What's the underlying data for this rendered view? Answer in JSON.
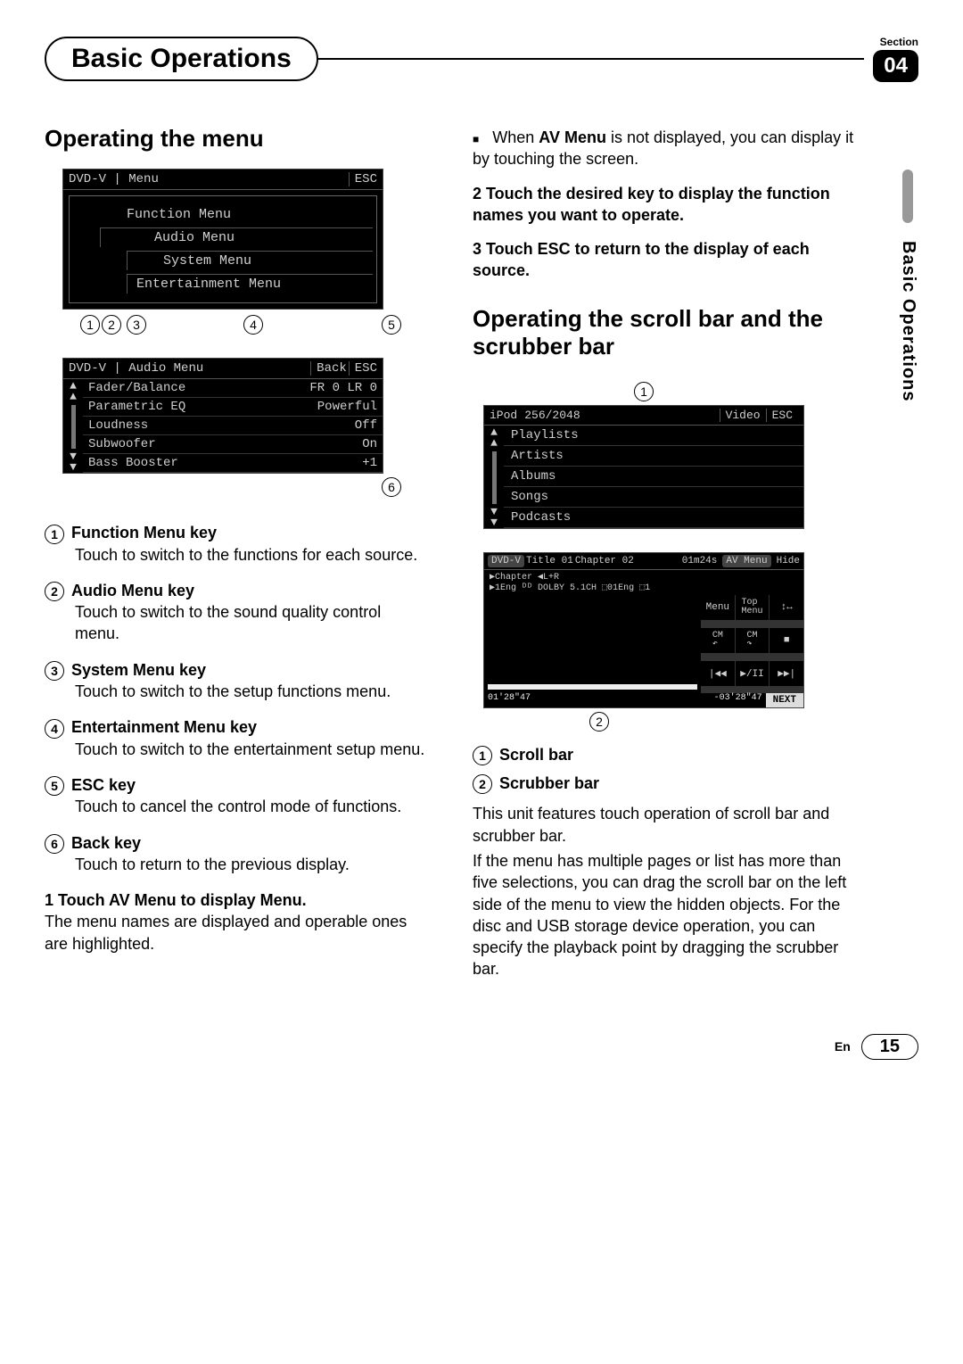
{
  "header": {
    "title": "Basic Operations",
    "section_label": "Section",
    "section_number": "04"
  },
  "side_tab": "Basic Operations",
  "left": {
    "heading": "Operating the menu",
    "menu_screen": {
      "source": "DVD-V",
      "title": "Menu",
      "esc": "ESC",
      "lines": [
        "Function Menu",
        "Audio Menu",
        "System Menu",
        "Entertainment Menu"
      ],
      "callouts": [
        "1",
        "2",
        "3",
        "4",
        "5"
      ]
    },
    "audio_screen": {
      "source": "DVD-V",
      "title": "Audio Menu",
      "back": "Back",
      "esc": "ESC",
      "rows": [
        {
          "name": "Fader/Balance",
          "val": "FR 0 LR 0"
        },
        {
          "name": "Parametric EQ",
          "val": "Powerful"
        },
        {
          "name": "Loudness",
          "val": "Off"
        },
        {
          "name": "Subwoofer",
          "val": "On"
        },
        {
          "name": "Bass Booster",
          "val": "+1"
        }
      ],
      "callout": "6"
    },
    "keys": [
      {
        "num": "1",
        "title": "Function Menu key",
        "desc": "Touch to switch to the functions for each source."
      },
      {
        "num": "2",
        "title": "Audio Menu key",
        "desc": "Touch to switch to the sound quality control menu."
      },
      {
        "num": "3",
        "title": "System Menu key",
        "desc": "Touch to switch to the setup functions menu."
      },
      {
        "num": "4",
        "title": "Entertainment Menu key",
        "desc": "Touch to switch to the entertainment setup menu."
      },
      {
        "num": "5",
        "title": "ESC key",
        "desc": "Touch to cancel the control mode of functions."
      },
      {
        "num": "6",
        "title": "Back key",
        "desc": "Touch to return to the previous display."
      }
    ],
    "step1_head": "1   Touch AV Menu to display Menu.",
    "step1_body": "The menu names are displayed and operable ones are highlighted."
  },
  "right": {
    "bullet1_pre": "When ",
    "bullet1_bold": "AV Menu",
    "bullet1_post": " is not displayed, you can display it by touching the screen.",
    "step2": "2   Touch the desired key to display the function names you want to operate.",
    "step3": "3   Touch ESC to return to the display of each source.",
    "heading": "Operating the scroll bar and the scrubber bar",
    "ipod": {
      "callout_top": "1",
      "source": "iPod",
      "counter": "256/2048",
      "video": "Video",
      "esc": "ESC",
      "rows": [
        "Playlists",
        "Artists",
        "Albums",
        "Songs",
        "Podcasts"
      ]
    },
    "dvd": {
      "source": "DVD-V",
      "title": "Title 01",
      "chapter": "Chapter 02",
      "time": "01m24s",
      "av_menu": "AV Menu",
      "hide": "Hide",
      "sub1": "▶Chapter  ◀L+R",
      "sub2": "▶1Eng ᴰᴰ DOLBY 5.1CH ⬚01Eng ⬚1",
      "btns": {
        "menu": "Menu",
        "top": "Top\nMenu",
        "arrows": "↕↔",
        "cm_l": "CM\n↶",
        "cm_r": "CM\n↷",
        "stop": "■",
        "prev": "|◀◀",
        "play": "▶/II",
        "next": "▶▶|"
      },
      "t_left": "01'28\"47",
      "t_right": "-03'28\"47",
      "next_btn": "NEXT",
      "callout": "2"
    },
    "labels": [
      {
        "num": "1",
        "title": "Scroll bar"
      },
      {
        "num": "2",
        "title": "Scrubber bar"
      }
    ],
    "body1": "This unit features touch operation of scroll bar and scrubber bar.",
    "body2": "If the menu has multiple pages or list has more than five selections, you can drag the scroll bar on the left side of the menu to view the hidden objects. For the disc and USB storage device operation, you can specify the playback point by dragging the scrubber bar."
  },
  "footer": {
    "lang": "En",
    "page": "15"
  }
}
